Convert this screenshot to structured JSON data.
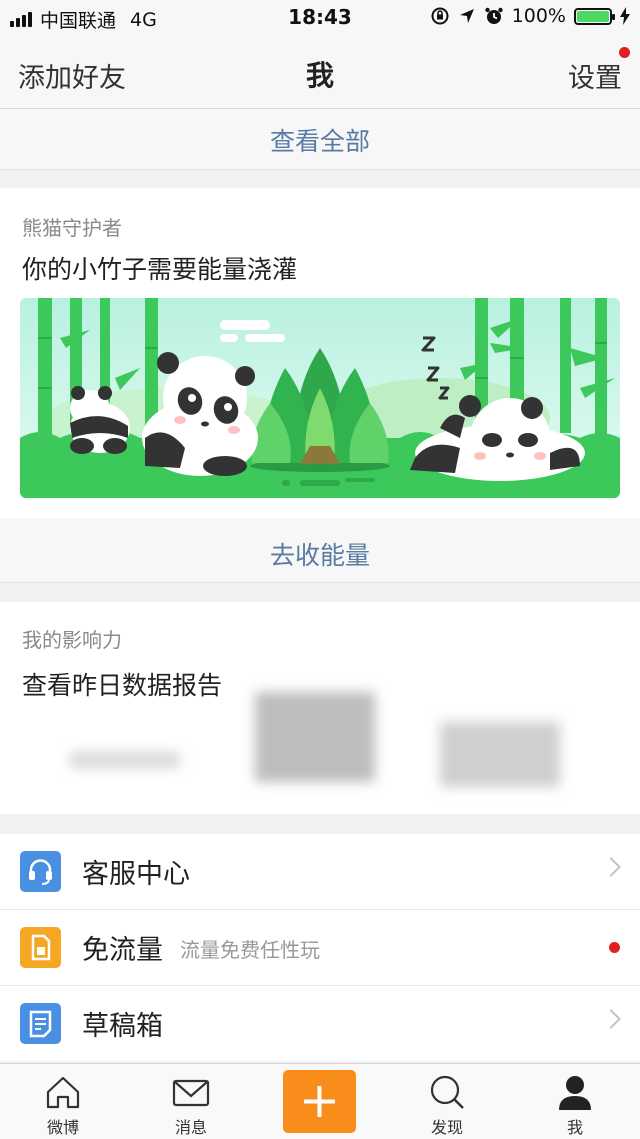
{
  "status_bar": {
    "carrier": "中国联通",
    "network": "4G",
    "time": "18:43",
    "battery": "100%",
    "battery_level": 1.0,
    "icons": [
      "rotation-lock-icon",
      "location-icon",
      "alarm-icon",
      "charging-icon"
    ]
  },
  "nav": {
    "left_label": "添加好友",
    "title": "我",
    "right_label": "设置"
  },
  "view_all": "查看全部",
  "panda_card": {
    "label": "熊猫守护者",
    "title": "你的小竹子需要能量浇灌",
    "action": "去收能量"
  },
  "influence_card": {
    "label": "我的影响力",
    "title": "查看昨日数据报告"
  },
  "menu": [
    {
      "label": "客服中心",
      "sub": "",
      "icon": "headset-icon",
      "color": "#4a90e2",
      "trailing": "chevron"
    },
    {
      "label": "免流量",
      "sub": "流量免费任性玩",
      "icon": "sim-card-icon",
      "color": "#f5a623",
      "trailing": "dot"
    },
    {
      "label": "草稿箱",
      "sub": "",
      "icon": "draft-icon",
      "color": "#4a90e2",
      "trailing": "chevron"
    }
  ],
  "tabs": [
    {
      "label": "微博",
      "icon": "home-icon"
    },
    {
      "label": "消息",
      "icon": "mail-icon"
    },
    {
      "label": "",
      "icon": "plus-icon"
    },
    {
      "label": "发现",
      "icon": "search-icon"
    },
    {
      "label": "我",
      "icon": "person-icon"
    }
  ],
  "colors": {
    "link": "#597ba3",
    "accent_orange": "#f98d1c",
    "notification_red": "#e02020",
    "banner_green": "#3cc85a"
  }
}
